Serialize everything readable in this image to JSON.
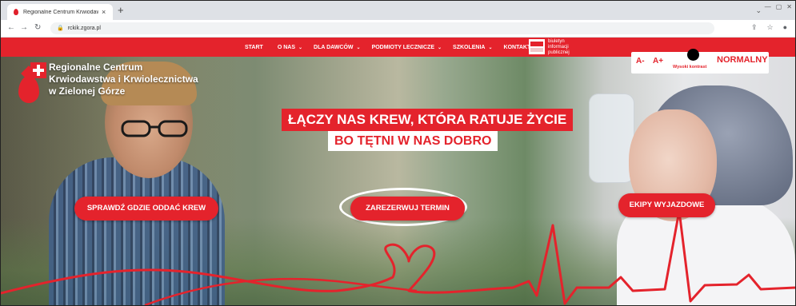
{
  "browser": {
    "tab_title": "Regionalne Centrum Krwiodawstwa",
    "tab_close": "×",
    "new_tab": "+",
    "url": "rckik.zgora.pl"
  },
  "nav": {
    "items": [
      {
        "label": "START",
        "caret": ""
      },
      {
        "label": "O NAS",
        "caret": "⌄"
      },
      {
        "label": "DLA DAWCÓW",
        "caret": "⌄"
      },
      {
        "label": "PODMIOTY LECZNICZE",
        "caret": "⌄"
      },
      {
        "label": "SZKOLENIA",
        "caret": "⌄"
      },
      {
        "label": "KONTAKT",
        "caret": ""
      }
    ],
    "bip": {
      "line1": "biuletyn",
      "line2": "informacji",
      "line3": "publicznej"
    }
  },
  "logo": {
    "line1": "Regionalne Centrum",
    "line2": "Krwiodawstwa i Krwiolecznictwa",
    "line3": "w Zielonej Górze"
  },
  "accessibility": {
    "a_minus": "A-",
    "a_plus": "A+",
    "high_contrast": "Wysoki kontrast",
    "normal": "NORMALNY"
  },
  "hero": {
    "headline1": "ŁĄCZY NAS KREW, KTÓRA RATUJE ŻYCIE",
    "headline2": "BO TĘTNI W NAS DOBRO"
  },
  "cta": {
    "left": "SPRAWDŹ GDZIE ODDAĆ KREW",
    "middle": "ZAREZERWUJ TERMIN",
    "right": "EKIPY WYJAZDOWE"
  },
  "colors": {
    "brand_red": "#e4232c",
    "white": "#ffffff"
  }
}
